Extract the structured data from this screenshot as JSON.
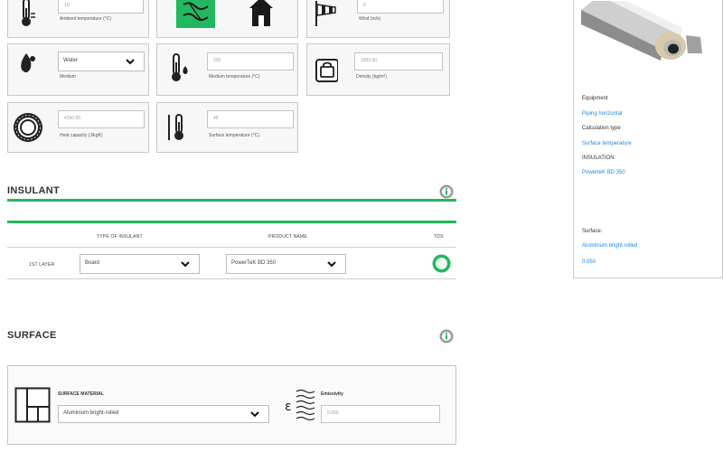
{
  "params": {
    "ambient_temperature": {
      "value": "10",
      "label": "Ambient temperature (°C)"
    },
    "location": {
      "outdoor_label": "Outdoor",
      "inside_label": "Inside The Building"
    },
    "wind": {
      "value": "0",
      "label": "Wind (m/s)"
    },
    "medium": {
      "value": "Water",
      "label": "Medium"
    },
    "medium_temperature": {
      "value": "200",
      "label": "Medium temperature (°C)"
    },
    "density": {
      "value": "1000.00",
      "label": "Density (kg/m³)"
    },
    "heat_capacity": {
      "value": "4190.00",
      "label": "Heat capacity (J/kgK)"
    },
    "surface_temperature": {
      "value": "40",
      "label": "Surface temperature (°C)"
    }
  },
  "insulant": {
    "heading": "INSULANT",
    "columns": [
      "TYPE OF INSULANT",
      "PRODUCT NAME",
      "TDS"
    ],
    "row_label": "1ST LAYER",
    "type_value": "Board",
    "product_value": "PowerTeK BD 350"
  },
  "surface": {
    "heading": "SURFACE",
    "material_label": "SURFACE MATERIAL",
    "material_value": "Aluminium bright-rolled",
    "emissivity_label": "Emissivity",
    "emissivity_value": "0.050"
  },
  "summary": {
    "equipment_label": "Equipment",
    "equipment_value": "Piping horizontal",
    "calc_label": "Calculation type",
    "calc_value": "Surface temperature",
    "insulation_label": "INSULATION:",
    "insulation_value": "PowerteK BD 350",
    "surface_label": "Surface:",
    "surface_value": "Aluminium bright-rolled",
    "emissivity_value": "0.050"
  },
  "colors": {
    "accent_green": "#22b85f",
    "link_blue": "#1e88d9"
  }
}
